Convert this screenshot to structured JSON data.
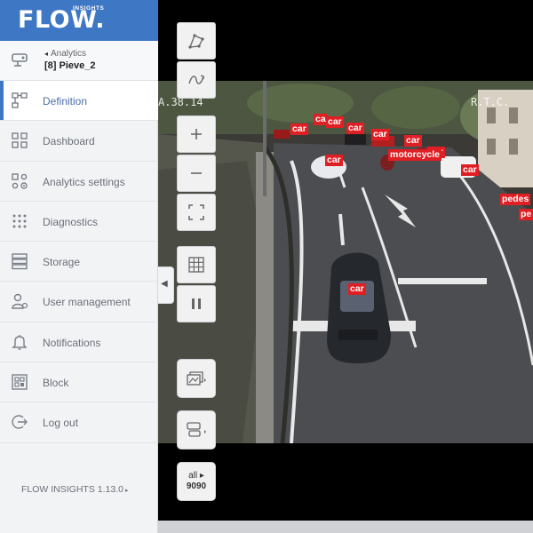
{
  "app": {
    "logo": "FLOW.",
    "logo_sub": "INSIGHTS",
    "version": "FLOW INSIGHTS 1.13.0",
    "version_caret": "▸"
  },
  "device": {
    "parent": "Analytics",
    "parent_caret": "◂",
    "name": "[8] Pieve_2"
  },
  "sidebar": {
    "items": [
      {
        "label": "Definition",
        "icon": "definition-icon",
        "active": true
      },
      {
        "label": "Dashboard",
        "icon": "dashboard-icon",
        "active": false
      },
      {
        "label": "Analytics settings",
        "icon": "analytics-settings-icon",
        "active": false
      },
      {
        "label": "Diagnostics",
        "icon": "diagnostics-icon",
        "active": false
      },
      {
        "label": "Storage",
        "icon": "storage-icon",
        "active": false
      },
      {
        "label": "User management",
        "icon": "user-icon",
        "active": false
      },
      {
        "label": "Notifications",
        "icon": "bell-icon",
        "active": false
      },
      {
        "label": "Block",
        "icon": "block-icon",
        "active": false
      },
      {
        "label": "Log out",
        "icon": "logout-icon",
        "active": false
      }
    ]
  },
  "toolbar": {
    "zoom_mode": "all ▸",
    "zoom_level": "9090",
    "collapse_caret": "◀"
  },
  "overlay": {
    "timestamp": "A.38.14",
    "camera_text": "R.T.C.",
    "detections": [
      "car",
      "car",
      "ca",
      "car",
      "car",
      "car",
      "car",
      "car",
      "motorcycle",
      "car",
      "pedes",
      "pe",
      "car"
    ]
  },
  "colors": {
    "brand": "#3e77c4",
    "detection": "#e01f24",
    "sidebar_bg": "#f2f3f5"
  }
}
